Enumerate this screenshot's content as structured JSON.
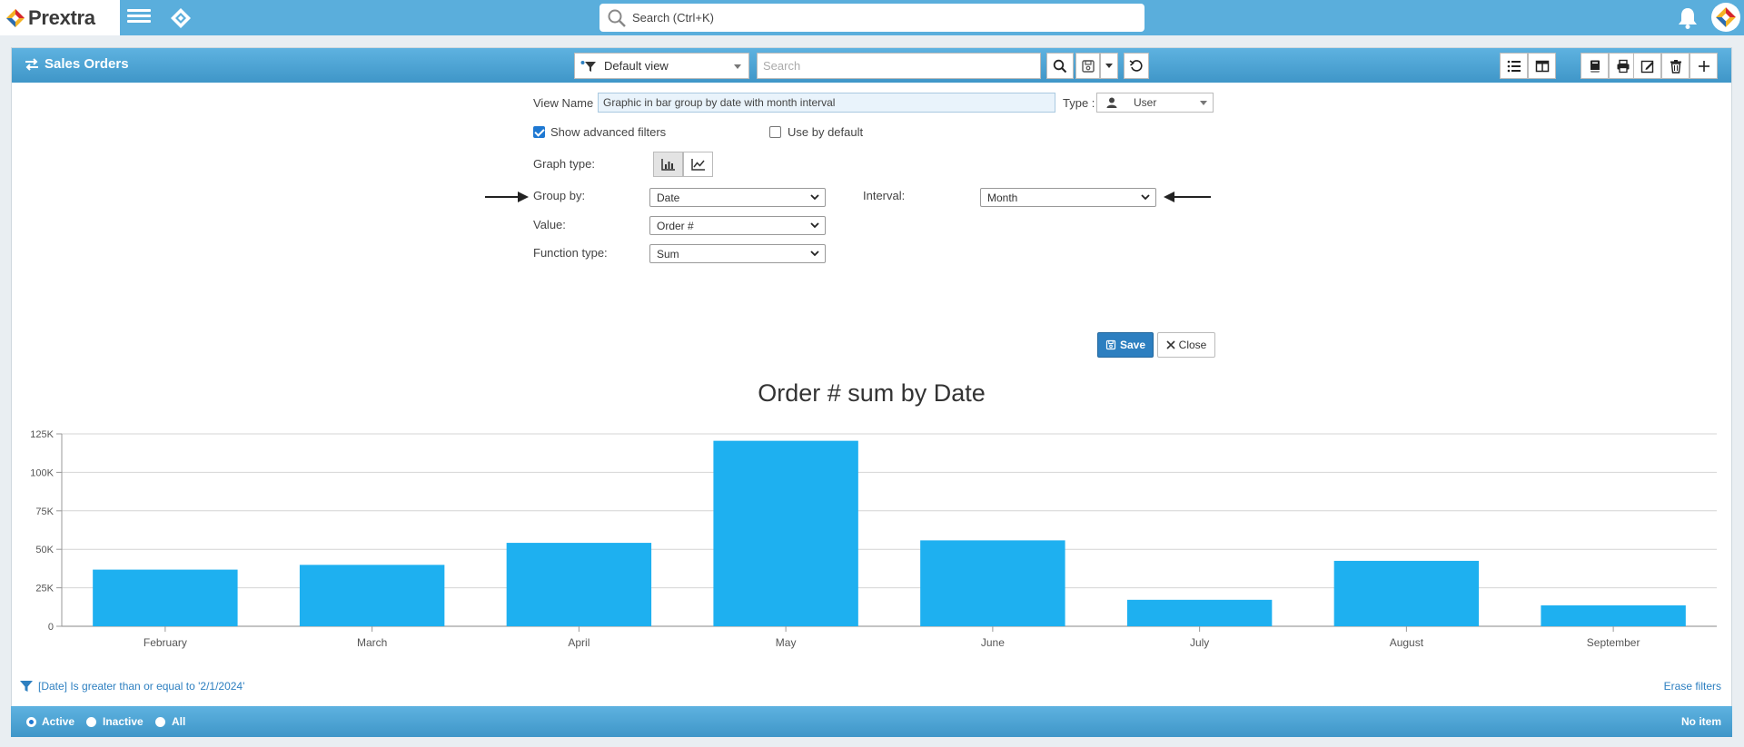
{
  "topbar": {
    "logo_text": "Prextra",
    "search_placeholder": "Search (Ctrl+K)"
  },
  "panel": {
    "title": "Sales Orders",
    "view_select": "Default view",
    "search_placeholder": "Search"
  },
  "form": {
    "view_name_label": "View Name :",
    "view_name_value": "Graphic in bar group by date with month interval",
    "type_label": "Type :",
    "type_value": "User",
    "show_advanced_filters": "Show advanced filters",
    "use_by_default": "Use by default",
    "graph_type_label": "Graph type:",
    "group_by_label": "Group by:",
    "group_by_value": "Date",
    "interval_label": "Interval:",
    "interval_value": "Month",
    "value_label": "Value:",
    "value_value": "Order #",
    "function_type_label": "Function type:",
    "function_type_value": "Sum",
    "save_label": "Save",
    "close_label": "Close"
  },
  "chart_data": {
    "type": "bar",
    "title": "Order # sum by Date",
    "categories": [
      "February",
      "March",
      "April",
      "May",
      "June",
      "July",
      "August",
      "September"
    ],
    "values": [
      36800,
      39900,
      54200,
      120500,
      55800,
      17200,
      42500,
      13600
    ],
    "ylim": [
      0,
      125000
    ],
    "yticks": [
      "0",
      "25K",
      "50K",
      "75K",
      "100K",
      "125K"
    ],
    "ytick_values": [
      0,
      25000,
      50000,
      75000,
      100000,
      125000
    ],
    "bar_color": "#1eb0f0",
    "grid": true,
    "legend": "none"
  },
  "filter": {
    "text": "[Date] Is greater than or equal to '2/1/2024'",
    "erase_label": "Erase filters"
  },
  "footer": {
    "active": "Active",
    "inactive": "Inactive",
    "all": "All",
    "count": "No item"
  }
}
